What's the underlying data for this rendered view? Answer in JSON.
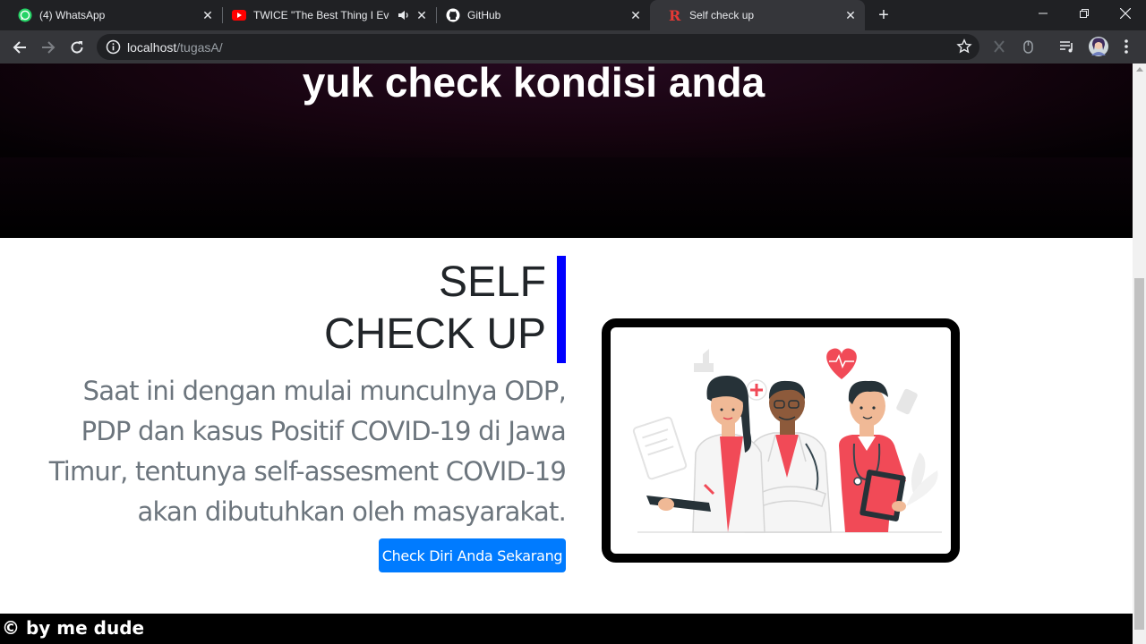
{
  "browser": {
    "tabs": [
      {
        "label": "(4) WhatsApp",
        "icon": "whatsapp-icon"
      },
      {
        "label": "TWICE \"The Best Thing I Ever Did\"",
        "icon": "youtube-icon",
        "audio": true
      },
      {
        "label": "GitHub",
        "icon": "github-icon"
      },
      {
        "label": "Self check up",
        "icon": "r-logo-icon",
        "active": true
      }
    ],
    "url_host": "localhost",
    "url_path": "/tugasA/"
  },
  "page": {
    "hero_title": "yuk check kondisi anda",
    "heading_line1": "SELF",
    "heading_line2": "CHECK UP",
    "lead": "Saat ini dengan mulai munculnya ODP, PDP dan kasus Positif COVID-19 di Jawa Timur, tentunya self-assesment COVID-19 akan dibutuhkan oleh masyarakat.",
    "cta_label": "Check Diri Anda Sekarang",
    "footer_text": "© by me dude"
  },
  "colors": {
    "accent_bar": "#0000ff",
    "button": "#007bff",
    "lead_text": "#6c757d",
    "illustration_red": "#f14a57"
  }
}
